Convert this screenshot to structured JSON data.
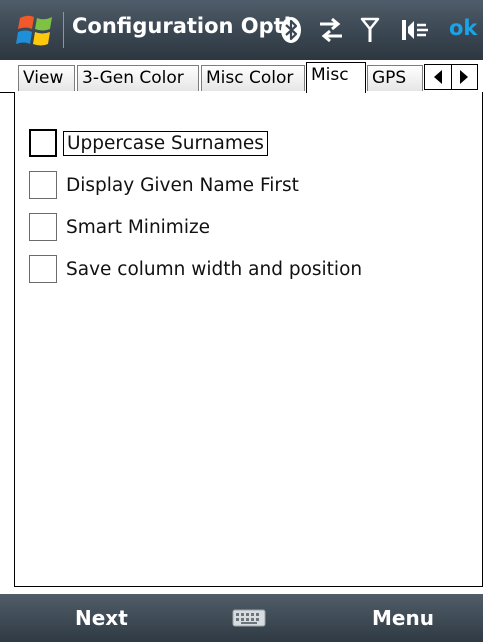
{
  "title_bar": {
    "title": "Configuration Opti",
    "ok_label": "ok",
    "icons": [
      "windows-start-icon",
      "bluetooth-icon",
      "data-connection-icon",
      "signal-icon",
      "volume-icon"
    ]
  },
  "tabs": [
    {
      "label": "View",
      "active": false
    },
    {
      "label": "3-Gen Color",
      "active": false
    },
    {
      "label": "Misc Color",
      "active": false
    },
    {
      "label": "Misc",
      "active": true
    },
    {
      "label": "GPS",
      "active": false
    }
  ],
  "tab_scroll": {
    "left_icon": "arrow-left-icon",
    "right_icon": "arrow-right-icon"
  },
  "options": [
    {
      "label": "Uppercase Surnames",
      "checked": false,
      "focused": true
    },
    {
      "label": "Display Given Name First",
      "checked": false,
      "focused": false
    },
    {
      "label": "Smart Minimize",
      "checked": false,
      "focused": false
    },
    {
      "label": "Save column width and position",
      "checked": false,
      "focused": false
    }
  ],
  "menu_bar": {
    "left_softkey": "Next",
    "right_softkey": "Menu",
    "center_icon": "keyboard-icon"
  },
  "colors": {
    "bar_dark": "#3a4651",
    "ok_blue": "#1aa3e6"
  }
}
